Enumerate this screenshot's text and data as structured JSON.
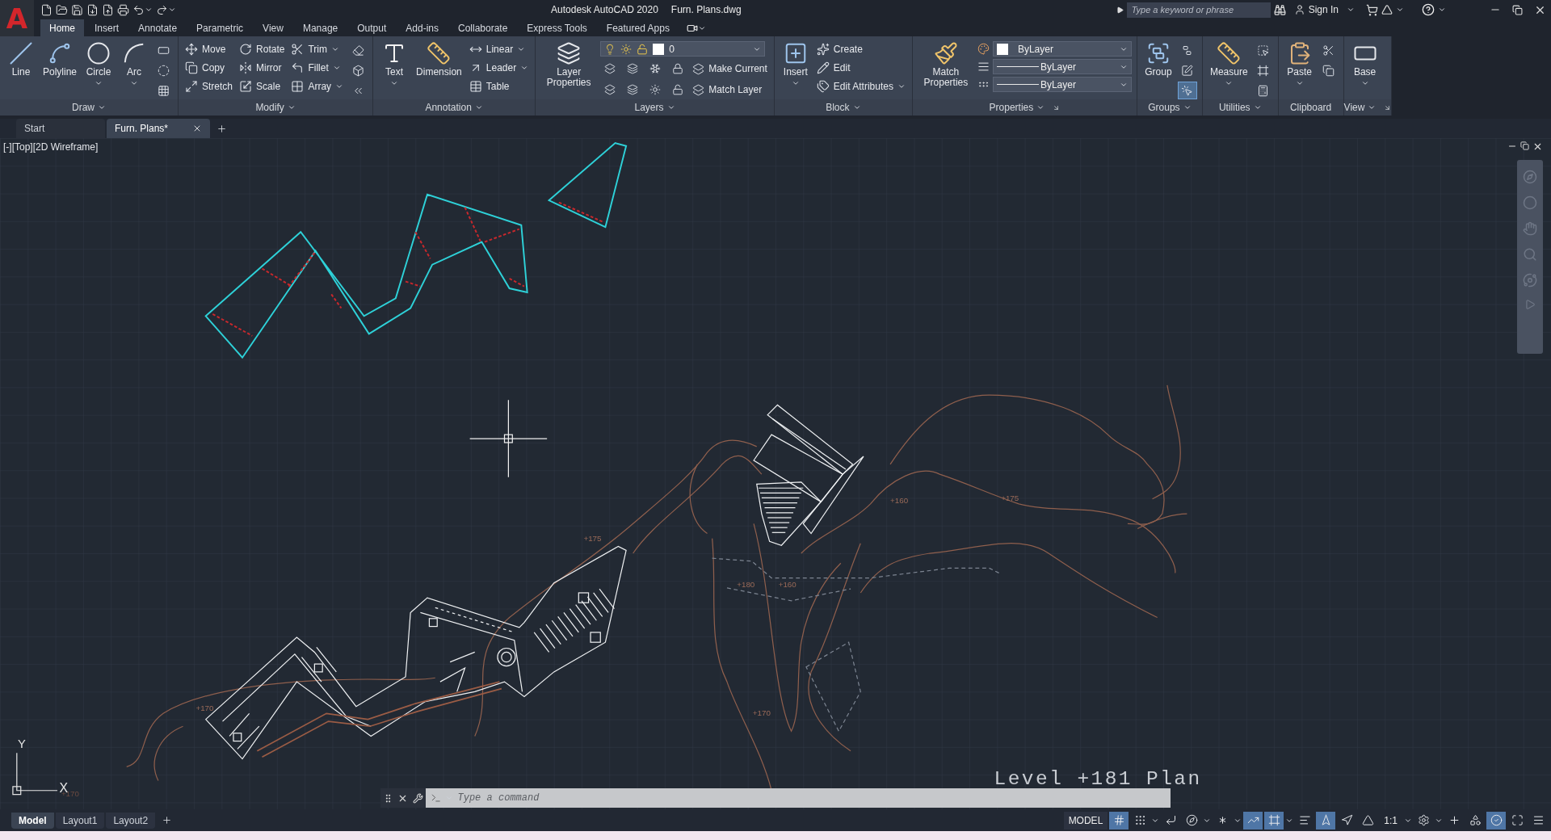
{
  "app_button": {
    "label": "A"
  },
  "title_bar": {
    "title": "Autodesk AutoCAD 2020",
    "file": "Furn. Plans.dwg",
    "search": {
      "placeholder": "Type a keyword or phrase"
    },
    "sign_in": "Sign In"
  },
  "ribbon_tabs": [
    {
      "label": "Home",
      "selected": true
    },
    {
      "label": "Insert",
      "selected": false
    },
    {
      "label": "Annotate",
      "selected": false
    },
    {
      "label": "Parametric",
      "selected": false
    },
    {
      "label": "View",
      "selected": false
    },
    {
      "label": "Manage",
      "selected": false
    },
    {
      "label": "Output",
      "selected": false
    },
    {
      "label": "Add-ins",
      "selected": false
    },
    {
      "label": "Collaborate",
      "selected": false
    },
    {
      "label": "Express Tools",
      "selected": false
    },
    {
      "label": "Featured Apps",
      "selected": false
    }
  ],
  "ribbon_panels": [
    {
      "title": "Draw",
      "has_menu": true,
      "launcher": false,
      "items": [
        {
          "kind": "large",
          "label": "Line",
          "has_menu": false
        },
        {
          "kind": "large",
          "label": "Polyline",
          "has_menu": false
        },
        {
          "kind": "large",
          "label": "Circle",
          "has_menu": true
        },
        {
          "kind": "large",
          "label": "Arc",
          "has_menu": true
        },
        {
          "kind": "icon_column",
          "icons": [
            {
              "on": false
            },
            {
              "on": false
            },
            {
              "on": false
            }
          ]
        }
      ]
    },
    {
      "title": "Modify",
      "has_menu": true,
      "launcher": false,
      "items": [
        {
          "kind": "column",
          "tools": [
            {
              "label": "Move",
              "has_menu": false
            },
            {
              "label": "Copy",
              "has_menu": false
            },
            {
              "label": "Stretch",
              "has_menu": false
            }
          ]
        },
        {
          "kind": "column",
          "tools": [
            {
              "label": "Rotate",
              "has_menu": false
            },
            {
              "label": "Mirror",
              "has_menu": false
            },
            {
              "label": "Scale",
              "has_menu": false
            }
          ]
        },
        {
          "kind": "column",
          "tools": [
            {
              "label": "Trim",
              "has_menu": true
            },
            {
              "label": "Fillet",
              "has_menu": true
            },
            {
              "label": "Array",
              "has_menu": true
            }
          ]
        },
        {
          "kind": "icon_column",
          "icons": [
            {
              "on": false
            },
            {
              "on": false
            },
            {
              "on": false
            }
          ]
        }
      ]
    },
    {
      "title": "Annotation",
      "has_menu": true,
      "launcher": false,
      "items": [
        {
          "kind": "large",
          "label": "Text",
          "has_menu": true
        },
        {
          "kind": "large",
          "label": "Dimension",
          "has_menu": false
        },
        {
          "kind": "column",
          "tools": [
            {
              "label": "Linear",
              "has_menu": true
            },
            {
              "label": "Leader",
              "has_menu": true
            },
            {
              "label": "Table",
              "has_menu": false
            }
          ]
        }
      ]
    },
    {
      "title": "Layers",
      "has_menu": true,
      "launcher": false,
      "items": [
        {
          "kind": "large",
          "label": "Layer Properties",
          "has_menu": false
        },
        {
          "kind": "layer_controls",
          "layer": "0",
          "tools": [
            {
              "label": "Make Current"
            },
            {
              "label": "Match Layer"
            }
          ]
        }
      ]
    },
    {
      "title": "Block",
      "has_menu": true,
      "launcher": false,
      "items": [
        {
          "kind": "large",
          "label": "Insert",
          "has_menu": true
        },
        {
          "kind": "column",
          "tools": [
            {
              "label": "Create",
              "has_menu": false
            },
            {
              "label": "Edit",
              "has_menu": false
            },
            {
              "label": "Edit Attributes",
              "has_menu": true
            }
          ]
        }
      ]
    },
    {
      "title": "Properties",
      "has_menu": true,
      "launcher": true,
      "items": [
        {
          "kind": "large",
          "label": "Match Properties",
          "has_menu": false
        },
        {
          "kind": "property_combos",
          "combos": [
            {
              "kind": "color",
              "value": "ByLayer"
            },
            {
              "kind": "linetype",
              "value": "ByLayer"
            },
            {
              "kind": "lineweight",
              "value": "ByLayer"
            }
          ]
        }
      ]
    },
    {
      "title": "Groups",
      "has_menu": true,
      "launcher": false,
      "items": [
        {
          "kind": "large",
          "label": "Group",
          "has_menu": false
        },
        {
          "kind": "icon_column",
          "icons": [
            {
              "on": false
            },
            {
              "on": false
            },
            {
              "on": true
            }
          ]
        }
      ]
    },
    {
      "title": "Utilities",
      "has_menu": true,
      "launcher": false,
      "items": [
        {
          "kind": "large",
          "label": "Measure",
          "has_menu": true
        },
        {
          "kind": "icon_column",
          "icons": [
            {
              "on": false
            },
            {
              "on": false
            },
            {
              "on": false
            }
          ]
        }
      ]
    },
    {
      "title": "Clipboard",
      "has_menu": false,
      "launcher": false,
      "items": [
        {
          "kind": "large",
          "label": "Paste",
          "has_menu": true
        },
        {
          "kind": "icon_column",
          "icons": [
            {
              "on": false
            },
            {
              "on": false
            }
          ]
        }
      ]
    },
    {
      "title": "View",
      "has_menu": true,
      "launcher": true,
      "items": [
        {
          "kind": "large",
          "label": "Base",
          "has_menu": true
        }
      ]
    }
  ],
  "doc_tabs": [
    {
      "label": "Start",
      "selected": false,
      "closable": false
    },
    {
      "label": "Furn. Plans*",
      "selected": true,
      "closable": true
    }
  ],
  "viewport": {
    "label": "[-][Top][2D Wireframe]"
  },
  "drawing": {
    "elevation_labels": [
      "+175",
      "+160",
      "+175",
      "+180",
      "+160",
      "+170",
      "+170",
      "+170"
    ],
    "level_title": "Level +181 Plan",
    "axis_labels": [
      "Y",
      "X"
    ]
  },
  "command_line": {
    "placeholder": "Type a command"
  },
  "layout_tabs": [
    {
      "label": "Model",
      "selected": true
    },
    {
      "label": "Layout1",
      "selected": false
    },
    {
      "label": "Layout2",
      "selected": false
    }
  ],
  "status_bar": {
    "space": "MODEL",
    "toggles": [
      {
        "on": true
      },
      {
        "on": false
      },
      {
        "on": false
      },
      {
        "on": false
      },
      {
        "on": false
      },
      {
        "on": true
      },
      {
        "on": true
      },
      {
        "on": false
      },
      {
        "on": true
      },
      {
        "on": false
      },
      {
        "on": false
      }
    ],
    "scale": "1:1",
    "tail_toggles": [
      {
        "on": false
      },
      {
        "on": false
      },
      {
        "on": false
      },
      {
        "on": true
      },
      {
        "on": false
      },
      {
        "on": false
      }
    ]
  }
}
